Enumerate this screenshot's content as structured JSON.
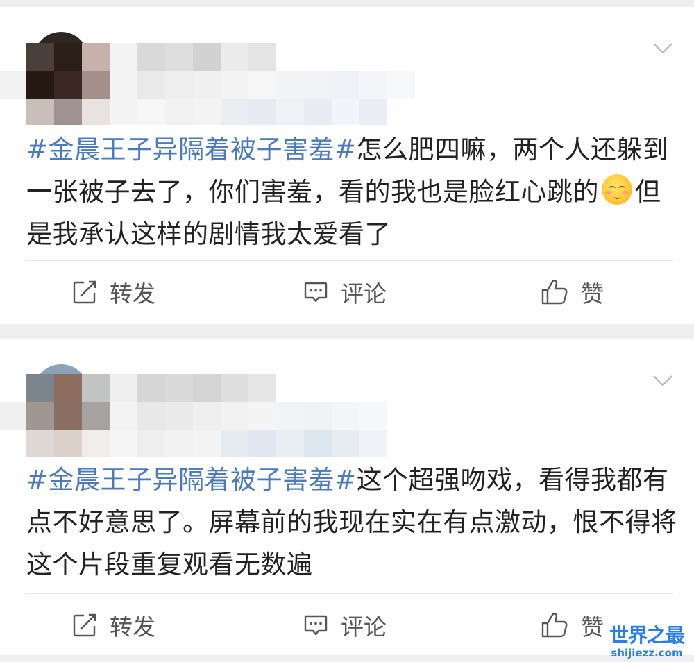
{
  "posts": [
    {
      "hashtag": "#金晨王子异隔着被子害羞#",
      "text_before_emoji": "怎么肥四嘛，两个人还躲到一张被子去了，你们害羞，看的我也是脸红心跳的",
      "emoji": "shy-blushing-face-emoji",
      "text_after_emoji": "但是我承认这样的剧情我太爱看了",
      "actions": {
        "repost": "转发",
        "comment": "评论",
        "like": "赞"
      }
    },
    {
      "hashtag": "#金晨王子异隔着被子害羞#",
      "text": "这个超强吻戏，看得我都有点不好意思了。屏幕前的我现在实在有点激动，恨不得将这个片段重复观看无数遍",
      "actions": {
        "repost": "转发",
        "comment": "评论",
        "like": "赞"
      }
    }
  ],
  "watermark": {
    "title": "世界之最",
    "url": "shijiezz.com"
  },
  "colors": {
    "hashtag": "#4d7ab8",
    "text": "#222222",
    "background": "#efeff1",
    "watermark": "#2a7ee8"
  }
}
